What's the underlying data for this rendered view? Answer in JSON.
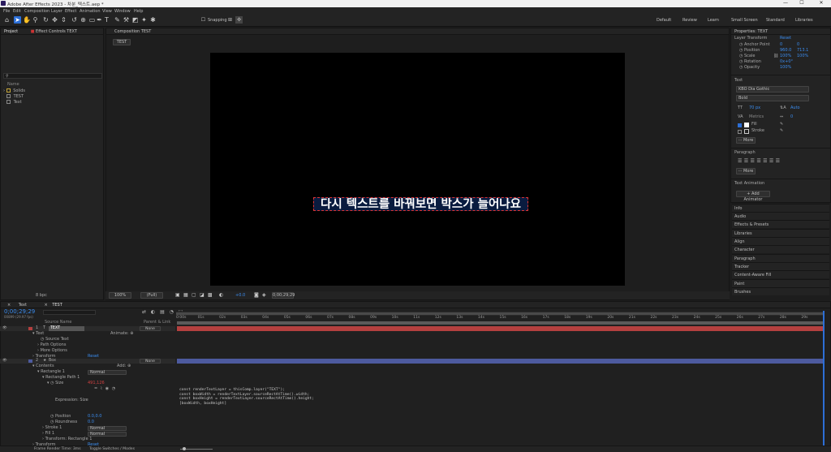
{
  "titlebar": {
    "title": "Adobe After Effects 2023 - 차분_텍스트.aep *",
    "min": "—",
    "max": "☐",
    "close": "✕"
  },
  "menu": [
    "File",
    "Edit",
    "Composition",
    "Layer",
    "Effect",
    "Animation",
    "View",
    "Window",
    "Help"
  ],
  "toolbar": {
    "snapping_label": "Snapping",
    "workspaces": [
      "Default",
      "Review",
      "Learn",
      "Small Screen",
      "Standard",
      "Libraries"
    ]
  },
  "project_panel": {
    "tab_project": "Project",
    "tab_effect_controls": "Effect Controls TEXT",
    "search_placeholder": "",
    "col_name": "Name",
    "items": [
      {
        "name": "Solids",
        "type": "folder"
      },
      {
        "name": "TEST",
        "type": "comp"
      },
      {
        "name": "Text",
        "type": "comp"
      }
    ],
    "bpc": "8 bpc"
  },
  "composition_panel": {
    "tab": "Composition TEST",
    "subtab": "TEST",
    "zoom": "100%",
    "resolution": "(Full)",
    "exposure": "+0.0",
    "timecode": "0;00;29;29"
  },
  "canvas": {
    "caption": "다시 텍스트를 바꿔보면 박스가 늘어나요"
  },
  "properties_panel": {
    "title": "Properties: TEXT",
    "layer_transform": "Layer Transform",
    "reset": "Reset",
    "props": [
      {
        "label": "Anchor Point",
        "v1": "0",
        "v2": "0"
      },
      {
        "label": "Position",
        "v1": "960.0",
        "v2": "713.1"
      },
      {
        "label": "Scale",
        "v1": "100%",
        "v2": "100%"
      },
      {
        "label": "Rotation",
        "v1": "0x+0°",
        "v2": ""
      },
      {
        "label": "Opacity",
        "v1": "100%",
        "v2": ""
      }
    ],
    "text_header": "Text",
    "font": "KBO Dia Gothic",
    "style": "Bold",
    "font_size": "70 px",
    "leading": "Auto",
    "kerning": "Metrics",
    "tracking": "0",
    "fill": "Fill",
    "stroke": "Stroke",
    "more1": "More",
    "paragraph_header": "Paragraph",
    "more2": "More",
    "text_animation": "Text Animation",
    "add_animator": "Add Animator"
  },
  "right_panels": [
    "Info",
    "Audio",
    "Effects & Presets",
    "Libraries",
    "Align",
    "Character",
    "Paragraph",
    "Tracker",
    "Content-Aware Fill",
    "Paint",
    "Brushes"
  ],
  "timeline": {
    "tabs": [
      "Text",
      "TEST"
    ],
    "timecode": "0;00;29;29",
    "timecode_sub": "00899 (29.97 fps)",
    "col_source": "Source Name",
    "col_parent": "Parent & Link",
    "ticks": [
      "0:00s",
      "01s",
      "02s",
      "03s",
      "04s",
      "05s",
      "06s",
      "07s",
      "08s",
      "09s",
      "10s",
      "11s",
      "12s",
      "13s",
      "14s",
      "15s",
      "16s",
      "17s",
      "18s",
      "19s",
      "20s",
      "21s",
      "22s",
      "23s",
      "24s",
      "25s",
      "26s",
      "27s",
      "28s",
      "29s"
    ],
    "layers": [
      {
        "num": "1",
        "name": "TEXT",
        "parent": "None"
      },
      {
        "num": "2",
        "name": "Box",
        "parent": "None"
      }
    ],
    "rows": {
      "text": "Text",
      "animate": "Animate:",
      "source_text": "Source Text",
      "path_options": "Path Options",
      "more_options": "More Options",
      "transform": "Transform",
      "reset": "Reset",
      "contents": "Contents",
      "add": "Add:",
      "rect1": "Rectangle 1",
      "normal": "Normal",
      "rect_path": "Rectangle Path 1",
      "size": "Size",
      "size_val": "491,126",
      "expr_size": "Expression: Size",
      "position": "Position",
      "position_val": "0.0,0.0",
      "roundness": "Roundness",
      "roundness_val": "0.0",
      "stroke1": "Stroke 1",
      "fill1": "Fill 1",
      "transform_rect": "Transform: Rectangle 1",
      "transform2": "Transform"
    },
    "expression": [
      "const renderTextLayer = thisComp.layer(\"TEXT\");",
      "const boxWidth = renderTextLayer.sourceRectAtTime().width;",
      "const boxHeight = renderTextLayer.sourceRectAtTime().height;",
      "[boxWidth, boxHeight]"
    ],
    "footer_render": "Frame Render Time: 3ms",
    "footer_toggle": "Toggle Switches / Modes"
  },
  "colors": {
    "accent": "#2d6fd6",
    "layer_text": "#b4403f",
    "layer_box": "#4d5a9e",
    "caption_border": "#dd3333"
  }
}
